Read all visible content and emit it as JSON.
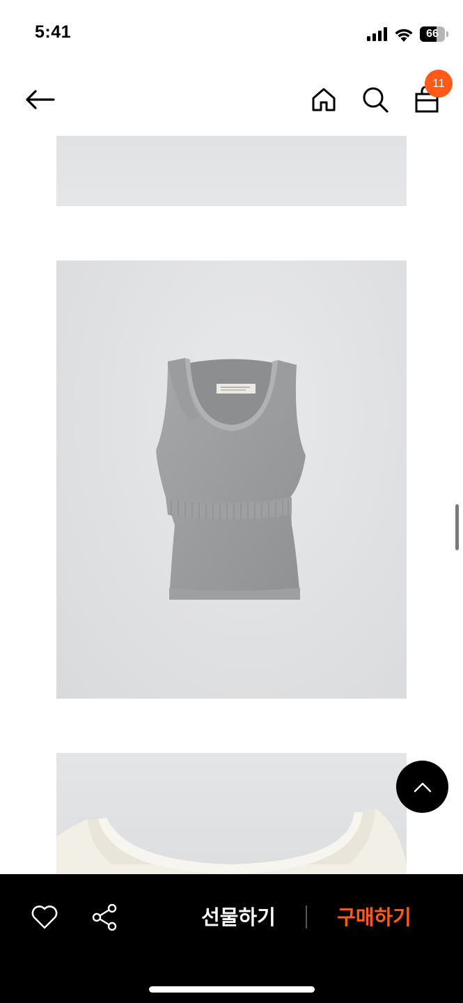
{
  "status_bar": {
    "time": "5:41",
    "battery_level": "66"
  },
  "header": {
    "cart_count": "11"
  },
  "colors": {
    "accent": "#ff5a1a",
    "bottom_bar": "#000000"
  },
  "icons": {
    "back": "arrow-left-icon",
    "home": "home-icon",
    "search": "search-icon",
    "cart": "shopping-bag-icon",
    "like": "heart-icon",
    "share": "share-icon",
    "top": "chevron-up-icon"
  },
  "bottom_bar": {
    "gift_label": "선물하기",
    "buy_label": "구매하기"
  }
}
